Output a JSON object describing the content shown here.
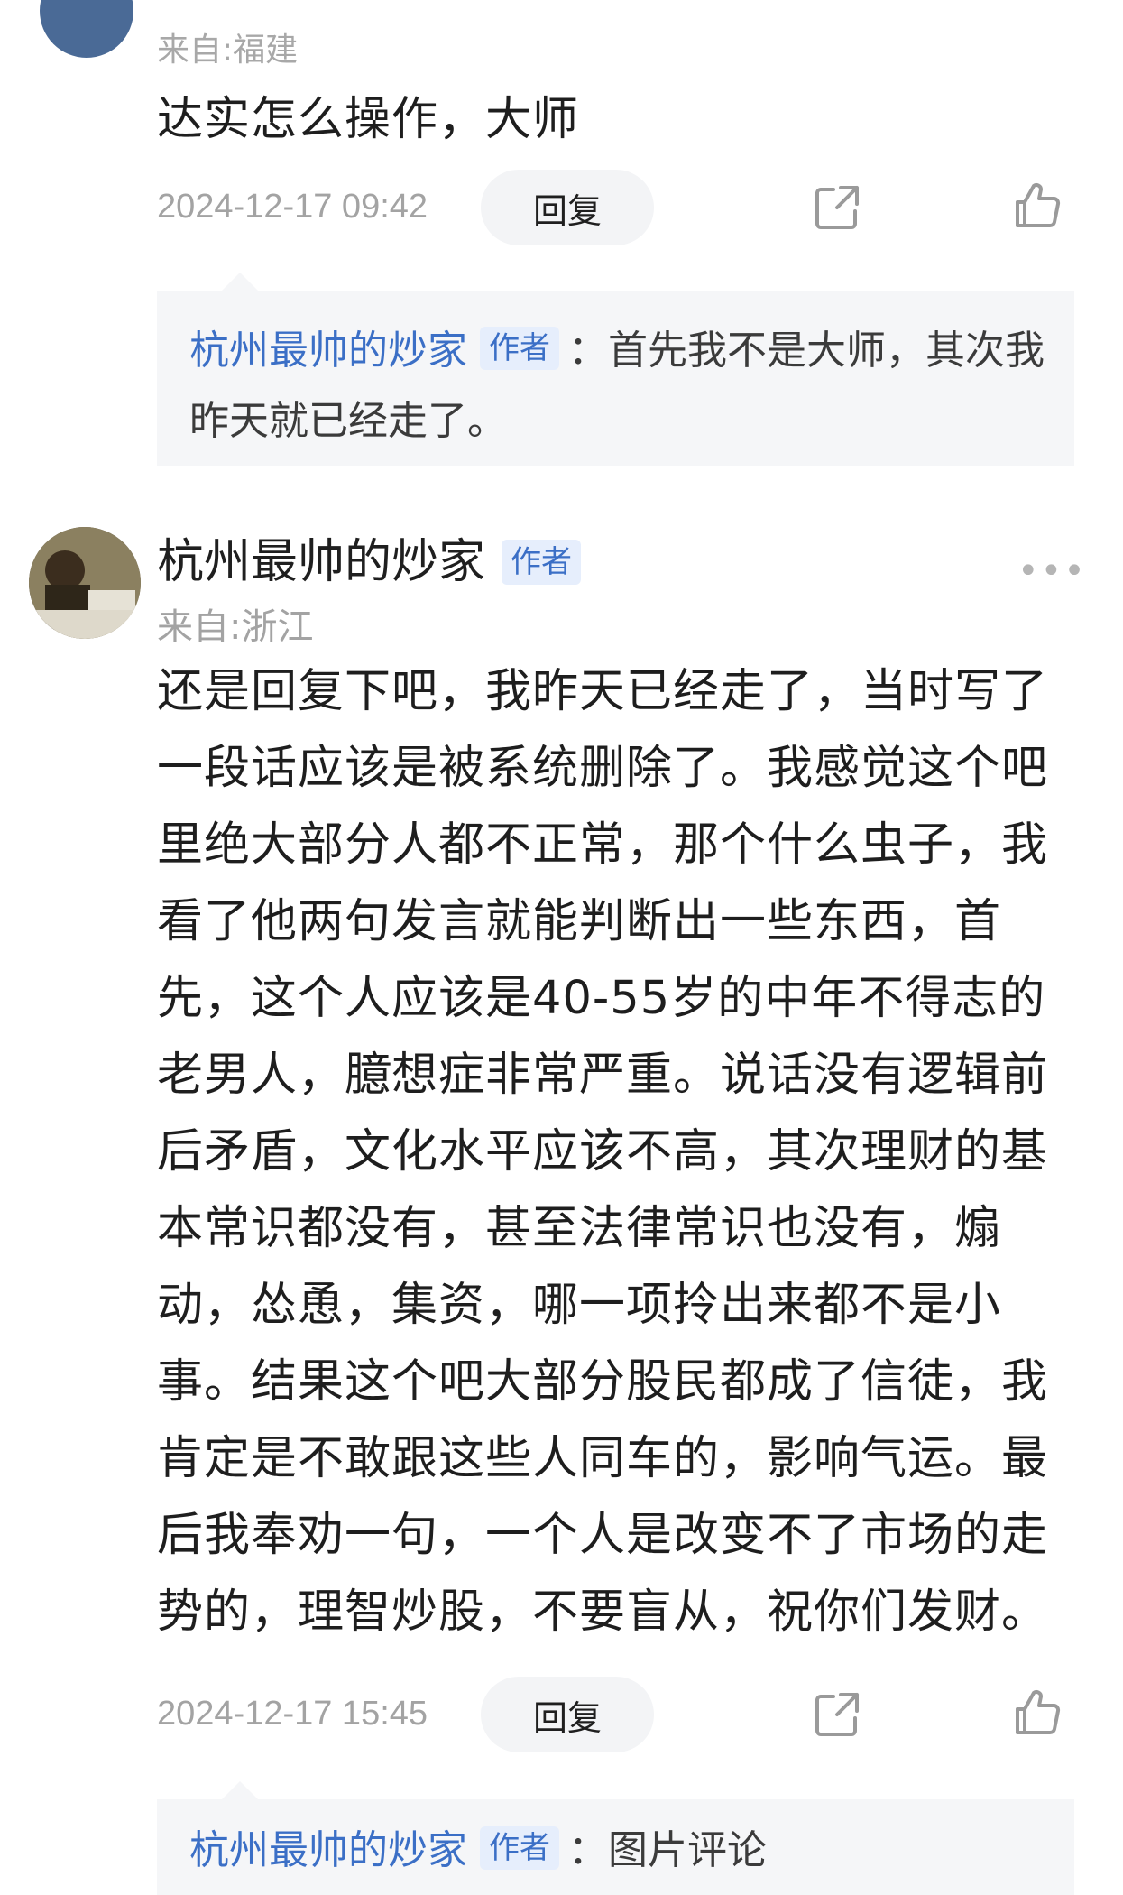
{
  "first_comment": {
    "source_label": "来自:福建",
    "text": "达实怎么操作，大师",
    "time": "2024-12-17 09:42",
    "reply_label": "回复",
    "reply": {
      "author": "杭州最帅的炒家",
      "badge": "作者",
      "colon": "：",
      "line1": "首先我不是大师，其次我",
      "line2": "昨天就已经走了。"
    }
  },
  "second_comment": {
    "user_name": "杭州最帅的炒家",
    "badge": "作者",
    "more": "•••",
    "source": "来自:浙江",
    "lines": [
      "还是回复下吧，我昨天已经走了，当时写了",
      "一段话应该是被系统删除了。我感觉这个吧",
      "里绝大部分人都不正常，那个什么虫子，我",
      "看了他两句发言就能判断出一些东西，首",
      "先，这个人应该是40-55岁的中年不得志的",
      "老男人，臆想症非常严重。说话没有逻辑前",
      "后矛盾，文化水平应该不高，其次理财的基",
      "本常识都没有，甚至法律常识也没有，煽",
      "动，怂恿，集资，哪一项拎出来都不是小",
      "事。结果这个吧大部分股民都成了信徒，我",
      "肯定是不敢跟这些人同车的，影响气运。最",
      "后我奉劝一句，一个人是改变不了市场的走",
      "势的，理智炒股，不要盲从，祝你们发财。"
    ],
    "time": "2024-12-17 15:45",
    "reply_label": "回复",
    "reply": {
      "author": "杭州最帅的炒家",
      "badge": "作者",
      "colon": "：",
      "text": "图片评论"
    }
  },
  "icons": {
    "share": "share-icon",
    "like": "thumbs-up-icon",
    "more": "more-icon"
  }
}
